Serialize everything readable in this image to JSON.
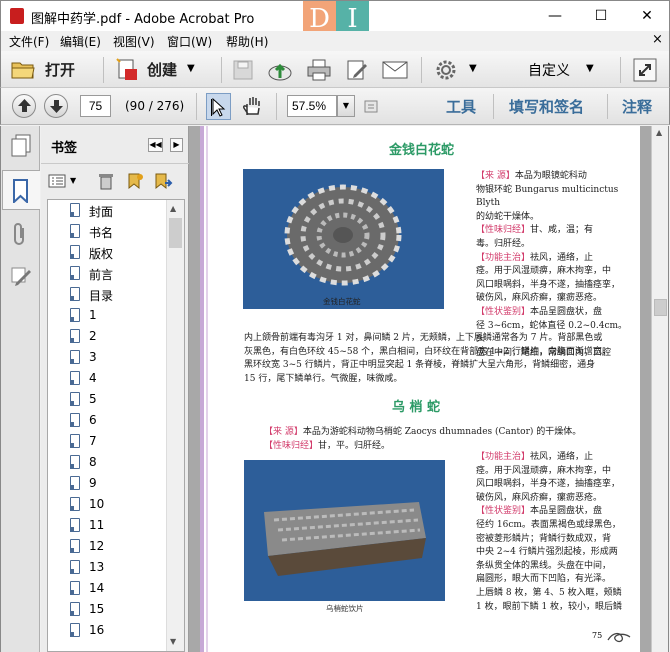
{
  "window": {
    "title": "图解中药学.pdf - Adobe Acrobat Pro",
    "logo_d": "D",
    "logo_i": "I",
    "min_glyph": "—",
    "max_glyph": "☐",
    "close_glyph": "✕"
  },
  "menu": {
    "items": [
      "文件(F)",
      "编辑(E)",
      "视图(V)",
      "窗口(W)",
      "帮助(H)"
    ],
    "close_glyph": "×"
  },
  "toolbar": {
    "open_label": "打开",
    "create_label": "创建",
    "customize_label": "自定义"
  },
  "nav": {
    "page_input": "75",
    "page_count": "(90 / 276)",
    "zoom": "57.5%",
    "tools_label": "工具",
    "fill_sign_label": "填写和签名",
    "comment_label": "注释"
  },
  "bookmarks": {
    "title": "书签",
    "items": [
      "封面",
      "书名",
      "版权",
      "前言",
      "目录",
      "1",
      "2",
      "3",
      "4",
      "5",
      "6",
      "7",
      "8",
      "9",
      "10",
      "11",
      "12",
      "13",
      "14",
      "15",
      "16"
    ]
  },
  "doc": {
    "title1": "金钱白花蛇",
    "s1_lines": [
      "【来    源】本品为眼镜蛇科动",
      "物银环蛇 Bungarus multicinctus Blyth",
      "的幼蛇干燥体。",
      "【性味归经】甘、咸，温；有",
      "毒。归肝经。",
      "【功能主治】祛风，通络，止",
      "痉。用于风湿顽痹，麻木拘挛，中",
      "风口眼㖞斜，半身不遂，抽搐痉挛，",
      "破伤风，麻风疥癣，瘰疬恶疮。",
      "【性状鉴别】本品呈圆盘状，盘",
      "径 3~6cm，蛇体直径 0.2~0.4cm。头",
      "盘在中间，尾细，常纳口内，口腔"
    ],
    "caption1": "金钱白花蛇",
    "s1_full": [
      "内上颌骨前端有毒沟牙 1 对，鼻间鳞 2 片，无颊鳞，上下唇鳞通常各为 7 片。背部黑色或",
      "灰黑色，有白色环纹 45~58 个，黑白相间，白环纹在背部宽 1~2 行鳞片，向腹面渐增宽，",
      "黑环纹宽 3~5 行鳞片，背正中明显突起 1 条脊棱，脊鳞扩大呈六角形，背鳞细密，通身",
      "15 行，尾下鳞单行。气微腥，味微咸。"
    ],
    "title2": "乌  梢  蛇",
    "s2_top": [
      "【来    源】本品为游蛇科动物乌梢蛇 Zaocys dhumnades (Cantor) 的干燥体。",
      "【性味归经】甘，平。归肝经。"
    ],
    "s2_lines": [
      "【功能主治】祛风，通络，止",
      "痉。用于风湿顽痹，麻木拘挛，中",
      "风口眼㖞斜，半身不遂，抽搐痉挛，",
      "破伤风，麻风疥癣，瘰疬恶疮。",
      "【性状鉴别】本品呈圆盘状，盘",
      "径约 16cm。表面黑褐色或绿黑色，",
      "密被菱形鳞片；背鳞行数成双，背",
      "中央 2~4 行鳞片强烈起棱，形成两",
      "条纵贯全体的黑线。头盘在中间，",
      "扁圆形，眼大而下凹陷，有光泽。",
      "上唇鳞 8 枚，第 4、5 枚入眶，颊鳞",
      "1 枚，眼前下鳞 1 枚，较小，眼后鳞"
    ],
    "caption2": "乌梢蛇饮片",
    "page_number": "75"
  }
}
